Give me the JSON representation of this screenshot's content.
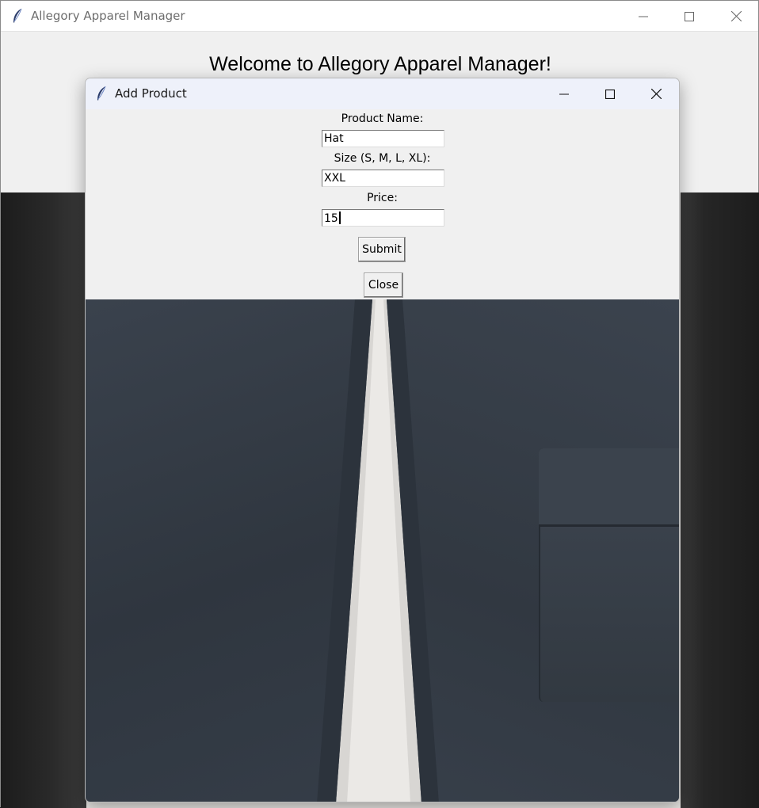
{
  "main_window": {
    "title": "Allegory Apparel Manager",
    "welcome_text": "Welcome to Allegory Apparel Manager!",
    "icon": "feather-icon"
  },
  "dialog": {
    "title": "Add Product",
    "icon": "feather-icon",
    "fields": {
      "product_name_label": "Product Name:",
      "product_name_value": "Hat",
      "size_label": "Size (S, M, L, XL):",
      "size_value": "XXL",
      "price_label": "Price:",
      "price_value": "15"
    },
    "submit_label": "Submit",
    "close_label": "Close"
  },
  "window_controls": [
    "minimize-icon",
    "maximize-icon",
    "close-icon"
  ],
  "colors": {
    "main_titlebar": "#ffffff",
    "dialog_titlebar": "#eef1fa",
    "body_bg": "#f0f0f0",
    "denim": "#333b45"
  }
}
